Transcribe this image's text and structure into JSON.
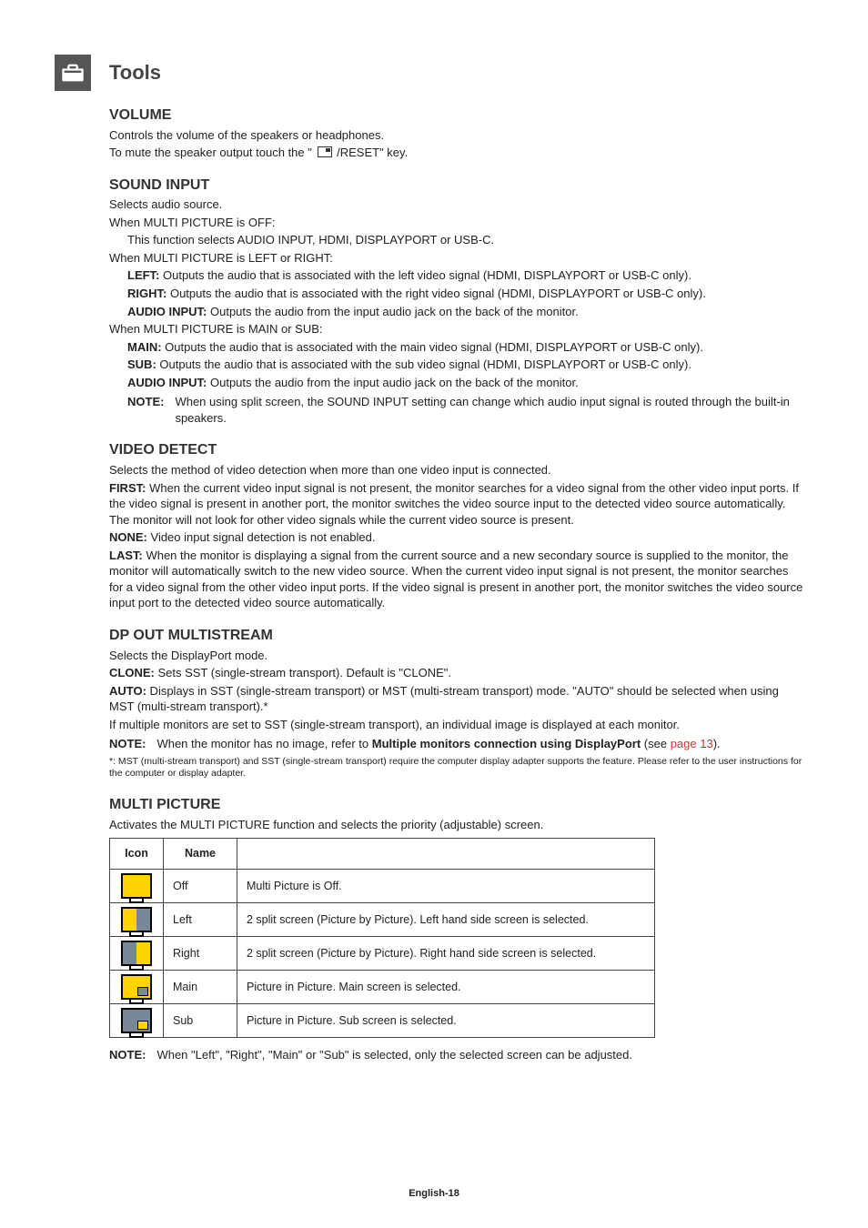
{
  "header": {
    "title": "Tools"
  },
  "volume": {
    "heading": "VOLUME",
    "p1": "Controls the volume of the speakers or headphones.",
    "p2a": "To mute the speaker output touch the \"",
    "p2b": "/RESET\" key."
  },
  "sound_input": {
    "heading": "SOUND INPUT",
    "p1": "Selects audio source.",
    "off_intro": "When MULTI PICTURE is OFF:",
    "off_text": "This function selects AUDIO INPUT, HDMI, DISPLAYPORT or USB-C.",
    "lr_intro": "When MULTI PICTURE is LEFT or RIGHT:",
    "left_label": "LEFT:",
    "left_text": " Outputs the audio that is associated with the left video signal (HDMI, DISPLAYPORT or USB-C only).",
    "right_label": "RIGHT:",
    "right_text": " Outputs the audio that is associated with the right video signal (HDMI, DISPLAYPORT or USB-C only).",
    "audioin_label": "AUDIO INPUT:",
    "audioin_text": " Outputs the audio from the input audio jack on the back of the monitor.",
    "ms_intro": "When MULTI PICTURE is MAIN or SUB:",
    "main_label": "MAIN:",
    "main_text": " Outputs the audio that is associated with the main video signal (HDMI, DISPLAYPORT or USB-C only).",
    "sub_label": "SUB:",
    "sub_text": " Outputs the audio that is associated with the sub video signal (HDMI, DISPLAYPORT or USB-C only).",
    "note_label": "NOTE:",
    "note_text": "When using split screen, the SOUND INPUT setting can change which audio input signal is routed through the built-in speakers."
  },
  "video_detect": {
    "heading": "VIDEO DETECT",
    "p1": "Selects the method of video detection when more than one video input is connected.",
    "first_label": "FIRST:",
    "first_text": " When the current video input signal is not present, the monitor searches for a video signal from the other video input ports. If the video signal is present in another port, the monitor switches the video source input to the detected video source automatically. The monitor will not look for other video signals while the current video source is present.",
    "none_label": "NONE:",
    "none_text": " Video input signal detection is not enabled.",
    "last_label": "LAST:",
    "last_text": " When the monitor is displaying a signal from the current source and a new secondary source is supplied to the monitor, the monitor will automatically switch to the new video source. When the current video input signal is not present, the monitor searches for a video signal from the other video input ports. If the video signal is present in another port, the monitor switches the video source input port to the detected video source automatically."
  },
  "dp_out": {
    "heading": "DP OUT MULTISTREAM",
    "p1": "Selects the DisplayPort mode.",
    "clone_label": "CLONE:",
    "clone_text": " Sets SST (single-stream transport). Default is \"CLONE\".",
    "auto_label": "AUTO:",
    "auto_text": " Displays in SST (single-stream transport) or MST (multi-stream transport) mode. \"AUTO\" should be selected when using MST (multi-stream transport).*",
    "sst_text": "If multiple monitors are set to SST (single-stream transport), an individual image is displayed at each monitor.",
    "note_label": "NOTE:",
    "note_text_a": "When the monitor has no image, refer to ",
    "note_bold": "Multiple monitors connection using DisplayPort",
    "note_text_b": " (see ",
    "note_link": "page 13",
    "note_text_c": ").",
    "footnote": "*: MST (multi-stream transport) and SST (single-stream transport) require the computer display adapter supports the feature. Please refer to the user instructions for the computer or display adapter."
  },
  "multi_picture": {
    "heading": "MULTI PICTURE",
    "p1": "Activates the MULTI PICTURE function and selects the priority (adjustable) screen.",
    "table": {
      "headers": {
        "icon": "Icon",
        "name": "Name",
        "desc": ""
      },
      "rows": [
        {
          "name": "Off",
          "desc": "Multi Picture is Off."
        },
        {
          "name": "Left",
          "desc": "2 split screen (Picture by Picture). Left hand side screen is selected."
        },
        {
          "name": "Right",
          "desc": "2 split screen (Picture by Picture). Right hand side screen is selected."
        },
        {
          "name": "Main",
          "desc": "Picture in Picture. Main screen is selected."
        },
        {
          "name": "Sub",
          "desc": "Picture in Picture. Sub screen is selected."
        }
      ]
    },
    "note_label": "NOTE:",
    "note_text": "When \"Left\", \"Right\", \"Main\" or \"Sub\" is selected, only the selected screen can be adjusted."
  },
  "page_number": "English-18"
}
